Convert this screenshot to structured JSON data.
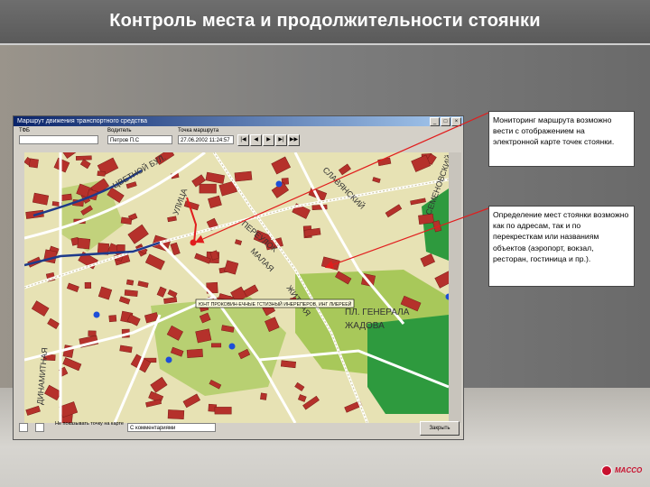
{
  "slide": {
    "title": "Контроль места и продолжительности стоянки"
  },
  "app": {
    "window_title": "Маршрут движения транспортного средства",
    "window_buttons": [
      "_",
      "□",
      "×"
    ],
    "toolbar": {
      "vehicle_label": "ТФБ",
      "driver_label": "Водитель",
      "driver_value": "Петров П.С",
      "time_label": "Точка маршрута",
      "time_value": "27.06.2002 11:24:57",
      "nav_buttons": [
        "|◀",
        "◀",
        "▶",
        "▶|",
        "▶▶"
      ]
    },
    "map": {
      "street_labels": [
        "ЦВЕТНОЙ БУЛ.",
        "УЛИЦА",
        "СЛАВЯНСКИЙ",
        "ПЕРЕУЛОК",
        "СЕМЕНОВСКИЙ",
        "ПЛ. ГЕНЕРАЛА",
        "ЖАДОВА",
        "ДИНАМИТНАЯ",
        "ЖИТНАЯ",
        "МАЛАЯ"
      ],
      "tooltip": "ЮНТ ПРОКОВИН-ЕЧНЫЕ ГСТИЗНЫЙ ИНЕРЕПЕРОВ, ИНГ ЛИЕРЕЕЙ"
    },
    "bottom": {
      "checkbox_text": "Не показывать точку на карте",
      "select_value": "С комментариями",
      "close_label": "Закрыть"
    }
  },
  "notes": {
    "note1": "Мониторинг маршрута возможно вести с отображением на электронной карте точек стоянки.",
    "note2": "Определение мест стоянки возможно как по адресам, так и по перекресткам или названиям объектов (аэропорт, вокзал, ресторан, гостиница и пр.)."
  },
  "logo": {
    "text": "MACCO"
  },
  "colors": {
    "title_bg": "#5a5a5a",
    "map_bg": "#e7e2b4",
    "building": "#b5312b",
    "route": "#1e3a8a",
    "arrow": "#e11d1d"
  }
}
